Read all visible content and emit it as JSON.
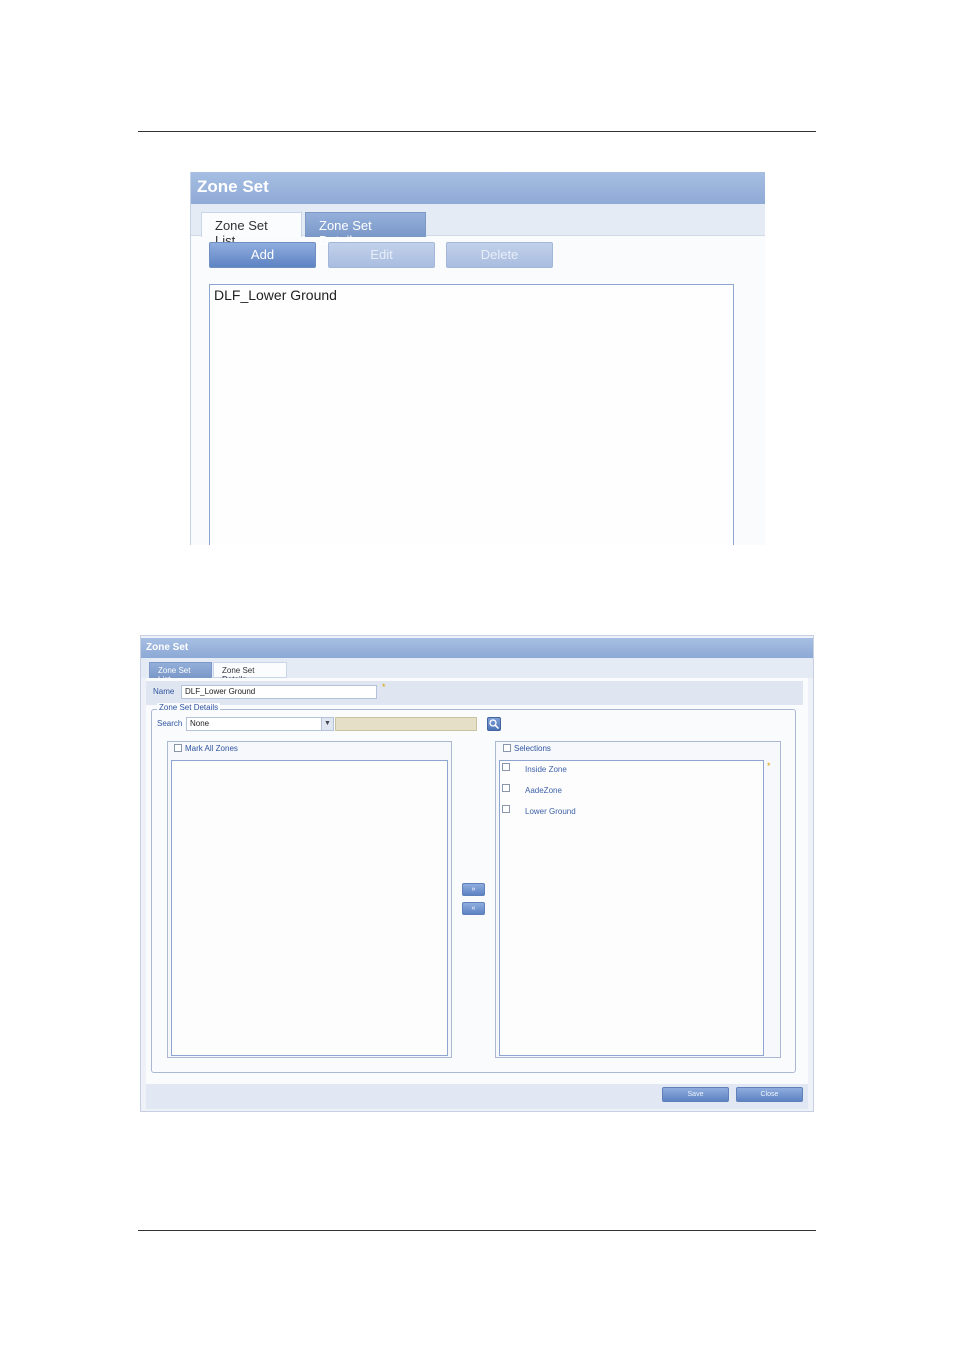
{
  "screenshot1": {
    "title": "Zone Set",
    "tabs": [
      {
        "label": "Zone Set List",
        "active": true
      },
      {
        "label": "Zone Set Details",
        "active": false
      }
    ],
    "buttons": {
      "add": "Add",
      "edit": "Edit",
      "delete": "Delete"
    },
    "list_items": [
      "DLF_Lower Ground"
    ]
  },
  "screenshot2": {
    "title": "Zone Set",
    "tabs": [
      {
        "label": "Zone Set List",
        "active": true
      },
      {
        "label": "Zone Set Details",
        "active": false
      }
    ],
    "name_label": "Name",
    "name_value": "DLF_Lower Ground",
    "required_mark": "*",
    "fieldset_legend": "Zone Set Details",
    "search_label": "Search",
    "search_selected": "None",
    "left_panel_header": "Mark All Zones",
    "right_panel_header": "Selections",
    "selections": [
      "Inside Zone",
      "AadeZone",
      "Lower Ground"
    ],
    "move_right": "»",
    "move_left": "«",
    "footer_buttons": {
      "save": "Save",
      "close": "Close"
    }
  },
  "colors": {
    "title_bar": "#8eaad6",
    "accent": "#5e83c3",
    "label_blue": "#2f55a0"
  }
}
